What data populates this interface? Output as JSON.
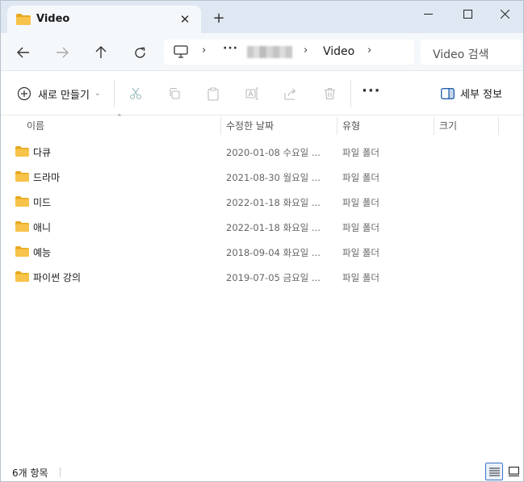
{
  "tab": {
    "title": "Video",
    "close_glyph": "✕",
    "new_tab_glyph": "+"
  },
  "window_controls": {
    "minimize": "minimize-icon",
    "maximize": "maximize-icon",
    "close": "close-icon"
  },
  "address_bar": {
    "more_glyph": "···",
    "separator": "›",
    "current_folder": "Video"
  },
  "search": {
    "placeholder": "Video 검색"
  },
  "command_bar": {
    "new_label": "새로 만들기",
    "new_chevron": "⌄",
    "more_glyph": "···",
    "details_label": "세부 정보"
  },
  "columns": {
    "name": "이름",
    "date_modified": "수정한 날짜",
    "type": "유형",
    "size": "크기",
    "sort_glyph": "⌃"
  },
  "files": [
    {
      "name": "다큐",
      "date": "2020-01-08 수요일 ...",
      "type": "파일 폴더"
    },
    {
      "name": "드라마",
      "date": "2021-08-30 월요일 ...",
      "type": "파일 폴더"
    },
    {
      "name": "미드",
      "date": "2022-01-18 화요일 ...",
      "type": "파일 폴더"
    },
    {
      "name": "애니",
      "date": "2022-01-18 화요일 ...",
      "type": "파일 폴더"
    },
    {
      "name": "예능",
      "date": "2018-09-04 화요일 ...",
      "type": "파일 폴더"
    },
    {
      "name": "파이썬 강의",
      "date": "2019-07-05 금요일 ...",
      "type": "파일 폴더"
    }
  ],
  "status": {
    "item_count": "6개 항목"
  },
  "colors": {
    "folder": "#F8C34A",
    "folder_dark": "#E6A91F",
    "title_bg": "#DFE8F2",
    "accent": "#3B76C4"
  }
}
